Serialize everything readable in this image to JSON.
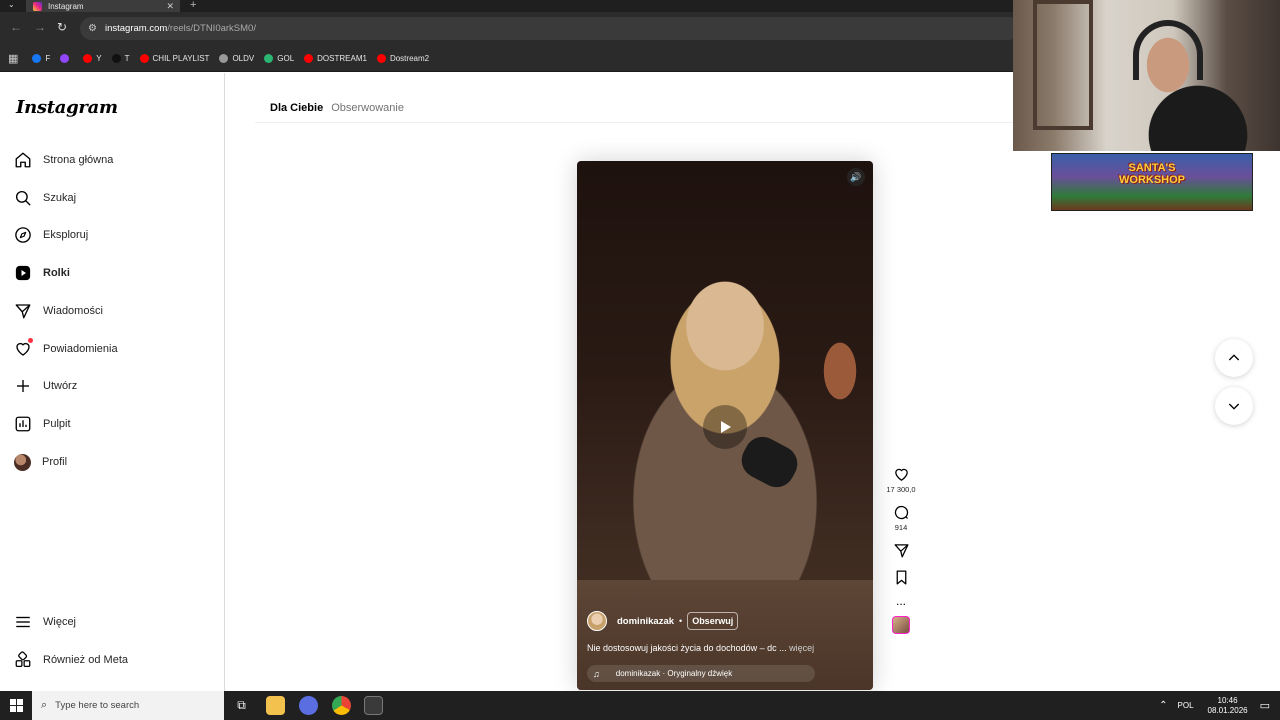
{
  "browser": {
    "tab_title": "Instagram",
    "tab_close": "✕",
    "new_tab": "+",
    "url_host": "instagram.com",
    "url_path": "/reels/DTNI0arkSM0/",
    "bookmarks": [
      {
        "label": "F",
        "color": "#1877f2"
      },
      {
        "label": "",
        "color": "#9146ff"
      },
      {
        "label": "Y",
        "color": "#ff0000"
      },
      {
        "label": "T",
        "color": "#111111"
      },
      {
        "label": "CHIL PLAYLIST",
        "color": "#ff0000"
      },
      {
        "label": "OLDV",
        "color": "#999999"
      },
      {
        "label": "GOL",
        "color": "#2bb673"
      },
      {
        "label": "DOSTREAM1",
        "color": "#ff0000"
      },
      {
        "label": "Dostream2",
        "color": "#ff0000"
      }
    ]
  },
  "sidebar": {
    "logo": "Instagram",
    "items": [
      {
        "label": "Strona główna",
        "icon": "home-icon"
      },
      {
        "label": "Szukaj",
        "icon": "search-icon"
      },
      {
        "label": "Eksploruj",
        "icon": "compass-icon"
      },
      {
        "label": "Rolki",
        "icon": "reels-icon",
        "active": true
      },
      {
        "label": "Wiadomości",
        "icon": "messages-icon"
      },
      {
        "label": "Powiadomienia",
        "icon": "heart-icon"
      },
      {
        "label": "Utwórz",
        "icon": "plus-icon"
      },
      {
        "label": "Pulpit",
        "icon": "dashboard-icon"
      },
      {
        "label": "Profil",
        "icon": "avatar"
      }
    ],
    "bottom": [
      {
        "label": "Więcej",
        "icon": "menu-icon"
      },
      {
        "label": "Również od Meta",
        "icon": "meta-apps-icon"
      }
    ]
  },
  "feed": {
    "tabs": [
      "Dla Ciebie",
      "Obserwowanie"
    ]
  },
  "reel": {
    "author": "dominikazak",
    "follow_label": "Obserwuj",
    "separator": "•",
    "caption": "Nie dostosowuj jakości życia do dochodów – dc ...",
    "more": "więcej",
    "audio": "dominikazak · Oryginalny dźwięk",
    "likes": "17 300,0",
    "comments": "914",
    "more_options": "..."
  },
  "overlay": {
    "banner_text": "SANTA'S WORKSHOP"
  },
  "taskbar": {
    "search_placeholder": "Type here to search",
    "lang": "POL",
    "time": "10:46",
    "date": "08.01.2026"
  }
}
